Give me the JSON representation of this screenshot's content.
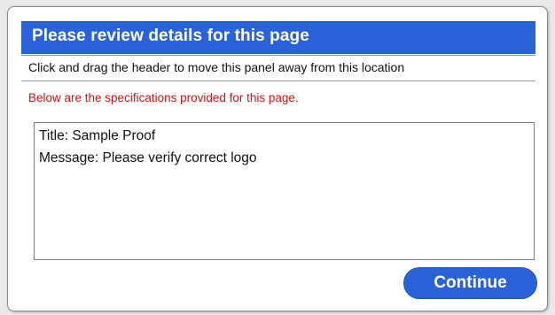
{
  "dialog": {
    "title": "Please review details for this page",
    "drag_hint": "Click and drag the header to move this panel away from this location",
    "spec_note": "Below are the specifications provided for this page.",
    "details": [
      "Title: Sample Proof",
      "Message: Please verify correct logo"
    ],
    "continue_label": "Continue"
  },
  "colors": {
    "header_bg": "#2a63d9",
    "note_text": "#d41212",
    "button_bg": "#2a63d9"
  }
}
